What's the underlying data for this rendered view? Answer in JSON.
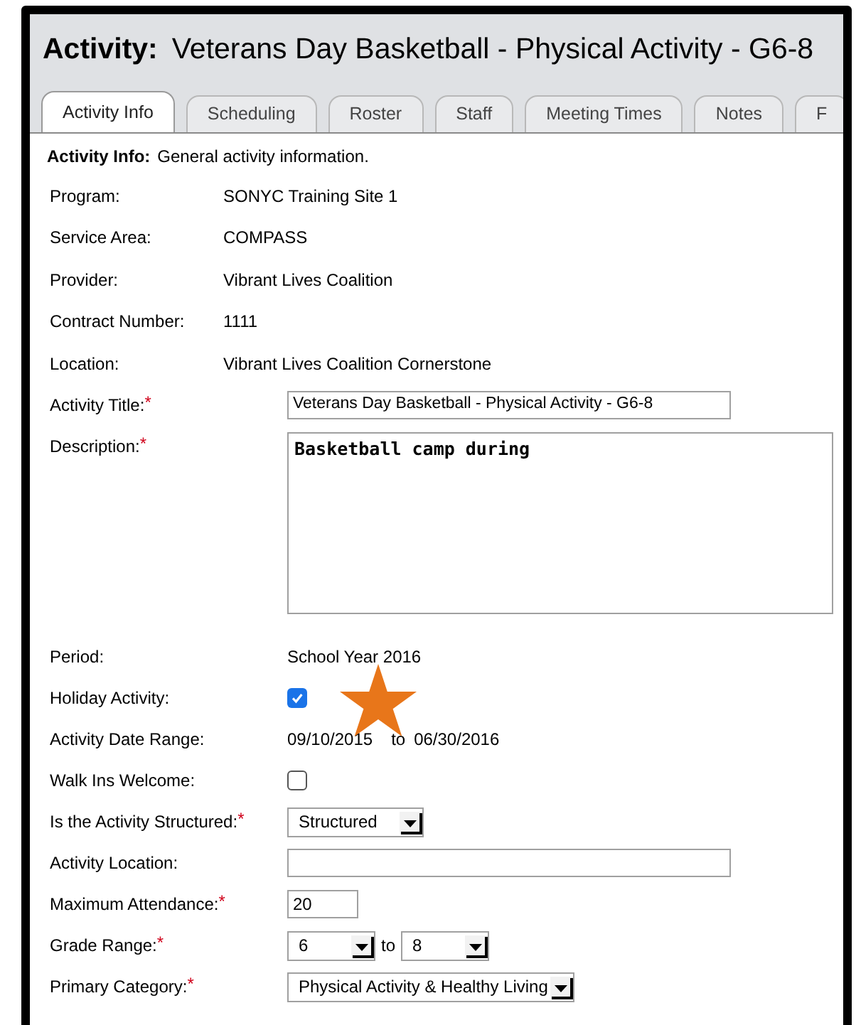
{
  "window": {
    "title_label": "Activity:",
    "title": "Veterans Day Basketball - Physical Activity - G6-8"
  },
  "tabs": [
    {
      "label": "Activity Info",
      "selected": true
    },
    {
      "label": "Scheduling",
      "selected": false
    },
    {
      "label": "Roster",
      "selected": false
    },
    {
      "label": "Staff",
      "selected": false
    },
    {
      "label": "Meeting Times",
      "selected": false
    },
    {
      "label": "Notes",
      "selected": false
    },
    {
      "label": "F",
      "selected": false
    }
  ],
  "required_mark": "*",
  "section": {
    "label": "Activity Info:",
    "text": "General activity information."
  },
  "fields": [
    {
      "kind": "text",
      "label": "Program:",
      "value": "SONYC Training Site 1",
      "required": false
    },
    {
      "kind": "text",
      "label": "Service Area:",
      "value": "COMPASS",
      "required": false
    },
    {
      "kind": "text",
      "label": "Provider:",
      "value": "Vibrant Lives Coalition",
      "required": false
    },
    {
      "kind": "text",
      "label": "Contract Number:",
      "value": "1111",
      "required": false
    },
    {
      "kind": "text",
      "label": "Location:",
      "value": "Vibrant Lives Coalition Cornerstone",
      "required": false
    },
    {
      "kind": "input",
      "label": "Activity Title:",
      "value": "Veterans Day Basketball - Physical Activity - G6-8",
      "required": true
    },
    {
      "kind": "textarea",
      "label": "Description:",
      "value": "Basketball camp during",
      "required": true
    },
    {
      "kind": "plain",
      "label": "Period:",
      "value": "School Year 2016",
      "required": false
    },
    {
      "kind": "checkbox",
      "label": "Holiday Activity:",
      "checked": true,
      "required": false
    },
    {
      "kind": "range",
      "label": "Activity Date Range:",
      "from": "09/10/2015",
      "joiner": "to",
      "to": "06/30/2016",
      "required": false
    },
    {
      "kind": "checkbox",
      "label": "Walk Ins Welcome:",
      "checked": false,
      "required": false
    },
    {
      "kind": "select",
      "label": "Is the Activity Structured:",
      "value": "Structured",
      "required": true
    },
    {
      "kind": "input_wide",
      "label": "Activity Location:",
      "required": false
    },
    {
      "kind": "input_short",
      "label": "Maximum Attendance:",
      "value": "20",
      "required": true
    },
    {
      "kind": "select_range",
      "label": "Grade Range:",
      "from": "6",
      "joiner": "to",
      "to": "8",
      "required": true
    },
    {
      "kind": "select_wide",
      "label": "Primary Category:",
      "value": "Physical Activity & Healthy Living",
      "required": true
    }
  ]
}
